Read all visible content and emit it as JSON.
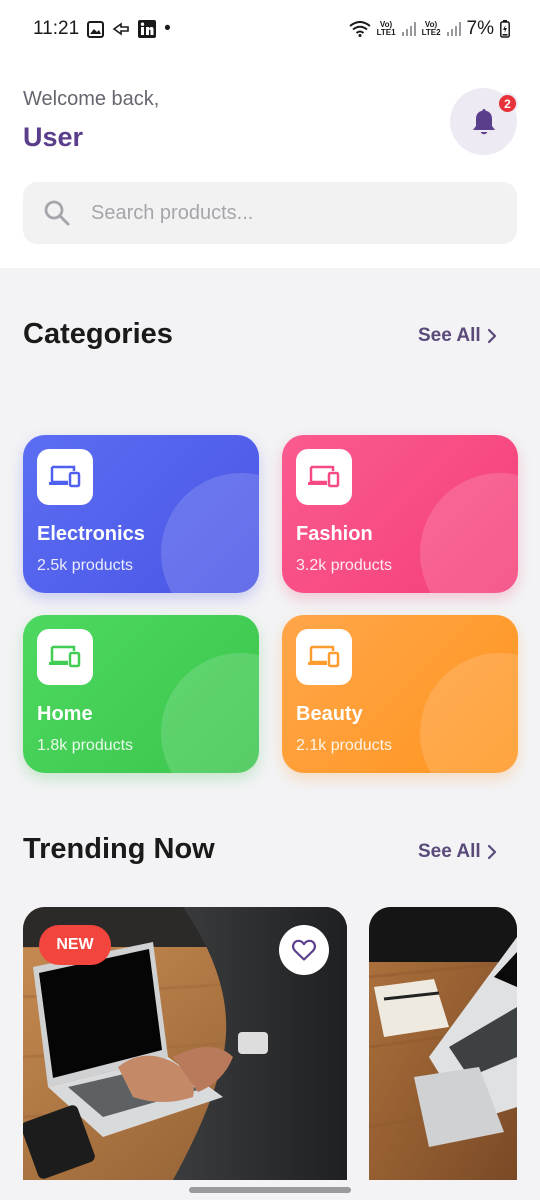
{
  "status_bar": {
    "time": "11:21",
    "dot": "•",
    "battery": "7%",
    "sim1_top": "Vo)",
    "sim1_bottom": "LTE1",
    "sim2_top": "Vo)",
    "sim2_bottom": "LTE2"
  },
  "header": {
    "welcome": "Welcome back,",
    "username": "User",
    "notification_count": "2"
  },
  "search": {
    "placeholder": "Search products..."
  },
  "categories": {
    "title": "Categories",
    "see_all": "See All",
    "items": [
      {
        "name": "Electronics",
        "count": "2.5k products",
        "color": "#4f5ff0",
        "icon_color": "#4f5ff0"
      },
      {
        "name": "Fashion",
        "count": "3.2k products",
        "color": "#f64b82",
        "icon_color": "#f64b82"
      },
      {
        "name": "Home",
        "count": "1.8k products",
        "color": "#41cc54",
        "icon_color": "#41cc54"
      },
      {
        "name": "Beauty",
        "count": "2.1k products",
        "color": "#ff9c30",
        "icon_color": "#ff9c30"
      }
    ]
  },
  "trending": {
    "title": "Trending Now",
    "see_all": "See All",
    "products": [
      {
        "badge": "NEW",
        "favorite": false,
        "image": "laptop-typing-photo"
      },
      {
        "image": "laptop-notebook-photo"
      }
    ]
  },
  "colors": {
    "accent": "#5a3e8c",
    "badge_red": "#e8333a",
    "new_badge": "#f2453d"
  }
}
